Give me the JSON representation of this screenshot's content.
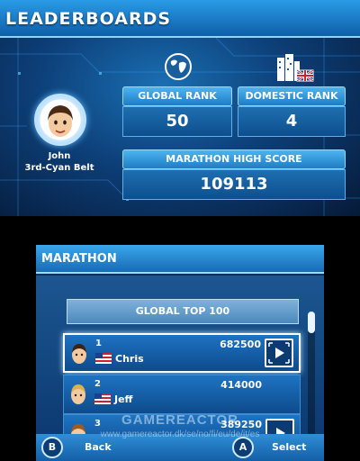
{
  "top": {
    "title": "LEADERBOARDS",
    "player": {
      "name": "John",
      "belt": "3rd-Cyan Belt"
    },
    "global_rank": {
      "label": "GLOBAL RANK",
      "value": "50",
      "icon": "globe-icon"
    },
    "domestic_rank": {
      "label": "DOMESTIC RANK",
      "value": "4",
      "icon": "city-uk-flag-icon"
    },
    "high_score": {
      "label": "MARATHON HIGH SCORE",
      "value": "109113"
    }
  },
  "bottom": {
    "title": "MARATHON",
    "banner": "GLOBAL TOP 100",
    "entries": [
      {
        "rank": "1",
        "name": "Chris",
        "score": "682500",
        "flag": "us-flag-icon",
        "selected": true
      },
      {
        "rank": "2",
        "name": "Jeff",
        "score": "414000",
        "flag": "us-flag-icon",
        "selected": false
      },
      {
        "rank": "3",
        "name": "",
        "score": "389250",
        "flag": "",
        "selected": false
      }
    ],
    "footer": {
      "back_key": "B",
      "back_label": "Back",
      "select_key": "A",
      "select_label": "Select"
    }
  },
  "watermark": {
    "brand": "GAMEREACTOR",
    "url": "www.gamereactor.dk/se/no/fi/eu/de/it/es"
  },
  "colors": {
    "accent": "#2a9be6",
    "panel": "#0d4f8e",
    "highlight": "#ffffff"
  }
}
